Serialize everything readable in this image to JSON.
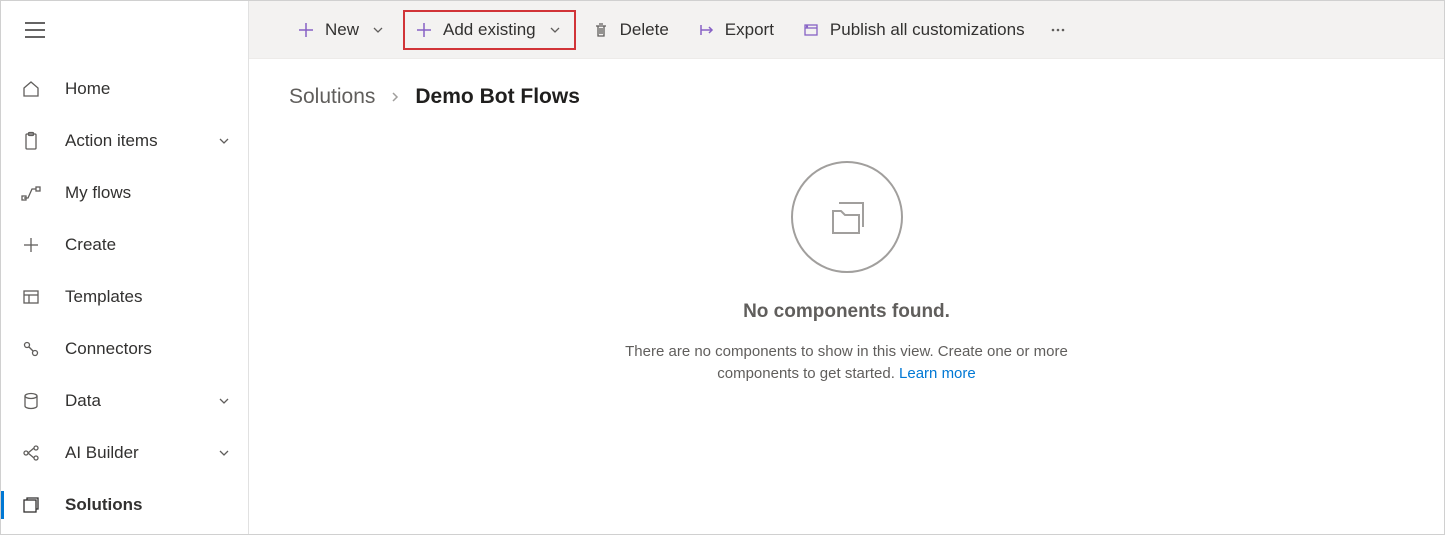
{
  "sidebar": {
    "items": [
      {
        "label": "Home",
        "icon": "home",
        "expandable": false,
        "selected": false
      },
      {
        "label": "Action items",
        "icon": "clipboard",
        "expandable": true,
        "selected": false
      },
      {
        "label": "My flows",
        "icon": "flow",
        "expandable": false,
        "selected": false
      },
      {
        "label": "Create",
        "icon": "plus",
        "expandable": false,
        "selected": false
      },
      {
        "label": "Templates",
        "icon": "templates",
        "expandable": false,
        "selected": false
      },
      {
        "label": "Connectors",
        "icon": "connector",
        "expandable": false,
        "selected": false
      },
      {
        "label": "Data",
        "icon": "database",
        "expandable": true,
        "selected": false
      },
      {
        "label": "AI Builder",
        "icon": "ai",
        "expandable": true,
        "selected": false
      },
      {
        "label": "Solutions",
        "icon": "solution",
        "expandable": false,
        "selected": true
      }
    ]
  },
  "toolbar": {
    "new_label": "New",
    "add_existing_label": "Add existing",
    "delete_label": "Delete",
    "export_label": "Export",
    "publish_label": "Publish all customizations"
  },
  "breadcrumb": {
    "root": "Solutions",
    "current": "Demo Bot Flows"
  },
  "empty_state": {
    "title": "No components found.",
    "description": "There are no components to show in this view. Create one or more components to get started.",
    "link_label": "Learn more"
  }
}
